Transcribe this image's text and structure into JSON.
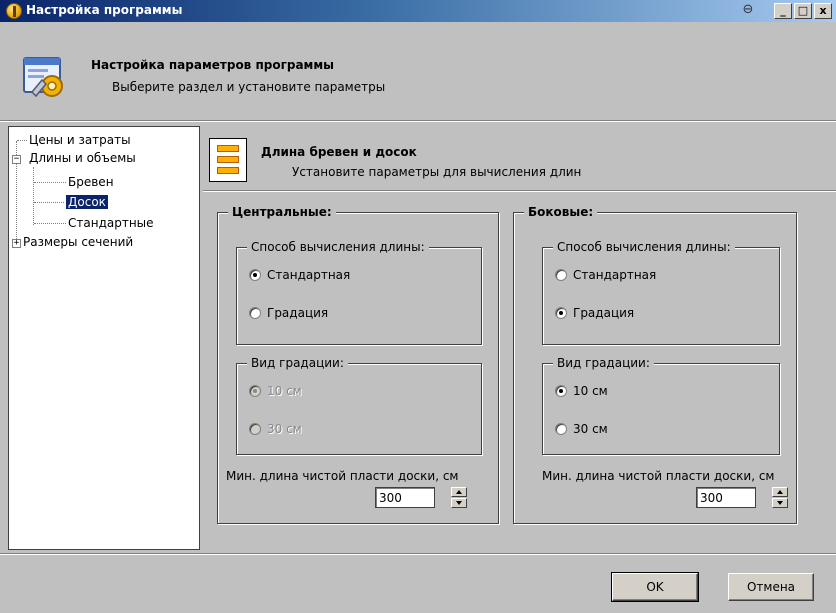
{
  "window": {
    "title": "Настройка программы",
    "pin_glyph": "⊖",
    "controls": {
      "minimize": "_",
      "maximize": "□",
      "close": "x"
    }
  },
  "header": {
    "title": "Настройка параметров программы",
    "subtitle": "Выберите раздел и установите параметры",
    "icon": "settings-window-icon"
  },
  "tree": {
    "items": [
      {
        "label": "Цены и затраты",
        "level": 0,
        "expander": ""
      },
      {
        "label": "Длины и объемы",
        "level": 0,
        "expander": "−"
      },
      {
        "label": "Бревен",
        "level": 1,
        "expander": ""
      },
      {
        "label": "Досок",
        "level": 1,
        "expander": "",
        "selected": true
      },
      {
        "label": "Стандартные",
        "level": 1,
        "expander": ""
      },
      {
        "label": "Размеры сечений",
        "level": 0,
        "expander": "+"
      }
    ]
  },
  "panel": {
    "title": "Длина бревен и досок",
    "subtitle": "Установите параметры для вычисления длин",
    "icon": "boards-icon",
    "central": {
      "title": "Центральные:",
      "method_title": "Способ вычисления длины:",
      "opt_standard": "Стандартная",
      "opt_gradation": "Градация",
      "method_selected": "standard",
      "grad_title": "Вид градации:",
      "grad_10": "10 см",
      "grad_30": "30 см",
      "grad_selected": "10",
      "grad_enabled": false,
      "min_label": "Мин. длина чистой пласти доски, см",
      "min_value": "300"
    },
    "side": {
      "title": "Боковые:",
      "method_title": "Способ вычисления длины:",
      "opt_standard": "Стандартная",
      "opt_gradation": "Градация",
      "method_selected": "gradation",
      "grad_title": "Вид градации:",
      "grad_10": "10 см",
      "grad_30": "30 см",
      "grad_selected": "10",
      "grad_enabled": true,
      "min_label": "Мин. длина чистой пласти доски, см",
      "min_value": "300"
    }
  },
  "buttons": {
    "ok": "OK",
    "cancel": "Отмена"
  },
  "colors": {
    "titlebar_start": "#0a246a",
    "titlebar_end": "#a6caf0",
    "face": "#c0c0c0",
    "selection": "#0a246a",
    "accent_orange": "#ffb000"
  }
}
